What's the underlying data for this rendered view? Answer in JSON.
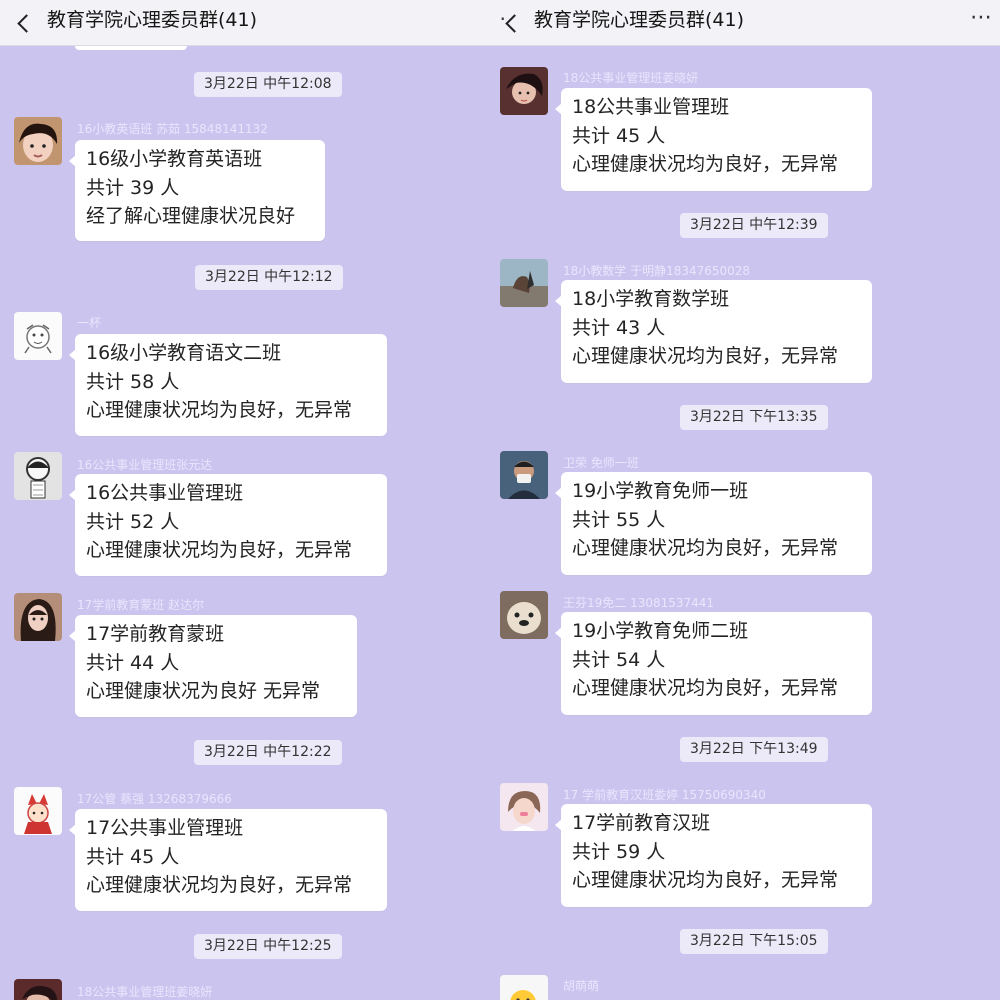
{
  "header": {
    "title": "教育学院心理委员群(41)",
    "more_icon": "more-dots-icon",
    "back_icon": "back-chevron-icon"
  },
  "left": {
    "timestamps": [
      "3月22日 中午12:08",
      "3月22日 中午12:12",
      "3月22日 中午12:22",
      "3月22日 中午12:25"
    ],
    "messages": [
      {
        "sender": "16小教英语班 苏茹 15848141132",
        "lines": [
          "16级小学教育英语班",
          "共计 39 人",
          "经了解心理健康状况良好"
        ]
      },
      {
        "sender": "一杯",
        "lines": [
          "16级小学教育语文二班",
          "共计 58 人",
          "心理健康状况均为良好，无异常"
        ]
      },
      {
        "sender": "16公共事业管理班张元达",
        "lines": [
          "16公共事业管理班",
          "共计 52 人",
          "心理健康状况均为良好，无异常"
        ]
      },
      {
        "sender": "17学前教育蒙班 赵达尔",
        "lines": [
          "17学前教育蒙班",
          "共计 44 人",
          "心理健康状况为良好  无异常"
        ]
      },
      {
        "sender": "17公管 蔡强 13268379666",
        "lines": [
          "17公共事业管理班",
          "共计 45 人",
          "心理健康状况均为良好，无异常"
        ]
      },
      {
        "sender": "18公共事业管理班姜晓妍",
        "lines": []
      }
    ]
  },
  "right": {
    "timestamps": [
      "3月22日 中午12:39",
      "3月22日 下午13:35",
      "3月22日 下午13:49",
      "3月22日 下午15:05"
    ],
    "messages": [
      {
        "sender": "18公共事业管理班姜晓妍",
        "lines": [
          "18公共事业管理班",
          "共计 45 人",
          "心理健康状况均为良好，无异常"
        ]
      },
      {
        "sender": "18小教数学 于明静18347650028",
        "lines": [
          "18小学教育数学班",
          "共计 43 人",
          "心理健康状况均为良好，无异常"
        ]
      },
      {
        "sender": "卫荣 免师一班",
        "lines": [
          "19小学教育免师一班",
          "共计 55 人",
          "心理健康状况均为良好，无异常"
        ]
      },
      {
        "sender": "王芬19免二 13081537441",
        "lines": [
          "19小学教育免师二班",
          "共计 54 人",
          "心理健康状况均为良好，无异常"
        ]
      },
      {
        "sender": "17 学前教育汉班娄婷 15750690340",
        "lines": [
          "17学前教育汉班",
          "共计 59 人",
          "心理健康状况均为良好，无异常"
        ]
      },
      {
        "sender": "胡萌萌",
        "lines": []
      }
    ]
  },
  "colors": {
    "chat_background": "#cbc4ee",
    "bubble": "#ffffff",
    "topbar": "#f3f2f6",
    "timestamp_pill": "#ece9f8"
  }
}
